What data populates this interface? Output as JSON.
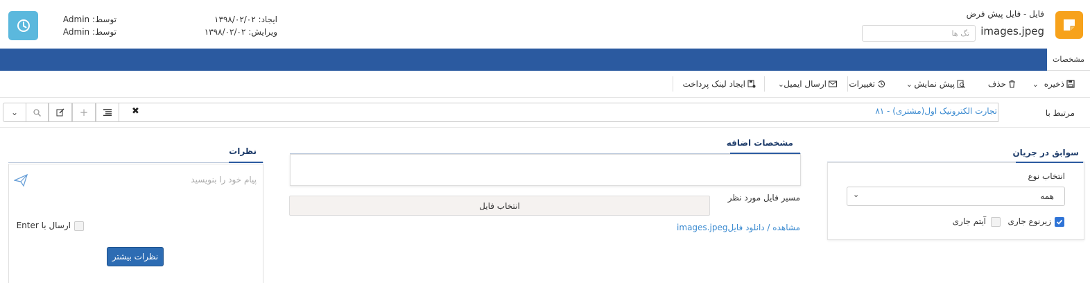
{
  "header": {
    "breadcrumb": "فایل -  فایل پیش فرض",
    "file_name": "images.jpeg",
    "tags_placeholder": "تگ ها",
    "created_label": "ایجاد:",
    "created_date": "۱۳۹۸/۰۲/۰۲",
    "modified_label": "ویرایش:",
    "modified_date": "۱۳۹۸/۰۲/۰۲",
    "by_label": "توسط:",
    "created_by": "Admin",
    "modified_by": "Admin",
    "logo_icon": "sticky-note-icon",
    "clock_icon": "clock-icon",
    "logo_color": "#f7a21b",
    "clock_color": "#5bb8dd"
  },
  "tabbar": {
    "active_tab": "مشخصات",
    "bar_color": "#2b5aa0"
  },
  "toolbar": {
    "save": "ذخیره",
    "delete": "حذف",
    "preview": "پیش نمایش",
    "changes": "تغییرات",
    "send_email": "ارسال ایمیل",
    "payment_link": "ایجاد لینک پرداخت"
  },
  "related": {
    "label": "مرتبط با",
    "value": "تجارت الکترونیک اول(مشتری) - ۸۱",
    "clear_icon": "close-icon"
  },
  "history_panel": {
    "title": "سوابق در جریان",
    "type_label": "انتخاب نوع",
    "type_value": "همه",
    "subtype_current": "زیرنوع جاری",
    "subtype_checked": true,
    "item_current": "آیتم جاری",
    "item_checked": false
  },
  "extra_panel": {
    "title": "مشخصات اضافه",
    "file_path_label": "مسیر فایل مورد نظر",
    "choose_file": "انتخاب فایل",
    "download_text": "مشاهده / دانلود فایل",
    "download_file": "images.jpeg"
  },
  "comments_panel": {
    "title": "نظرات",
    "placeholder": "پیام خود را بنویسید",
    "send_enter": "ارسال با Enter",
    "more_button": "نظرات بیشتر"
  }
}
